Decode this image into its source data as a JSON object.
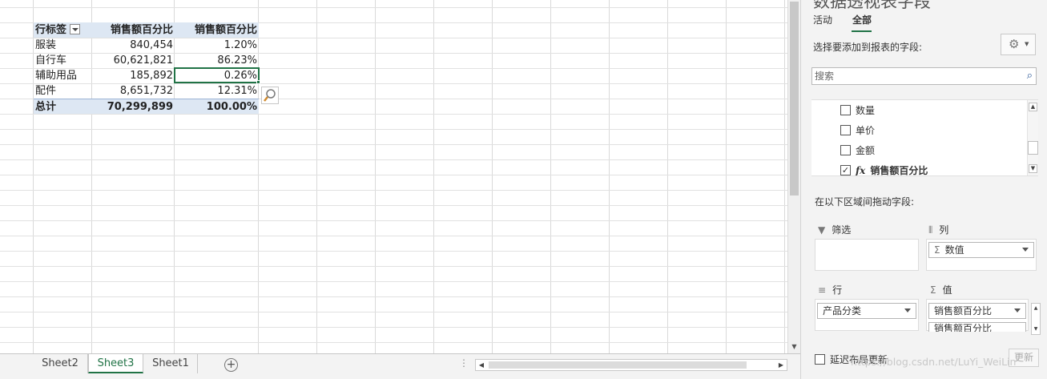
{
  "pivot": {
    "header": {
      "row_label": "行标签",
      "col2": "销售额百分比",
      "col3": "销售额百分比"
    },
    "rows": [
      {
        "label": "服装",
        "amount": "840,454",
        "pct": "1.20%"
      },
      {
        "label": "自行车",
        "amount": "60,621,821",
        "pct": "86.23%"
      },
      {
        "label": "辅助用品",
        "amount": "185,892",
        "pct": "0.26%"
      },
      {
        "label": "配件",
        "amount": "8,651,732",
        "pct": "12.31%"
      }
    ],
    "total": {
      "label": "总计",
      "amount": "70,299,899",
      "pct": "100.00%"
    }
  },
  "sheet_tabs": {
    "tab1": "Sheet2",
    "tab2": "Sheet3",
    "tab3": "Sheet1",
    "active": "Sheet3"
  },
  "panel": {
    "title": "数据透视表字段",
    "tab_active": "活动",
    "tab_all": "全部",
    "choose_label": "选择要添加到报表的字段:",
    "search_placeholder": "搜索",
    "fields": [
      {
        "name": "数量",
        "checked": false
      },
      {
        "name": "单价",
        "checked": false
      },
      {
        "name": "金额",
        "checked": false
      },
      {
        "name": "销售额百分比",
        "checked": true,
        "calc": "fx"
      }
    ],
    "drag_label": "在以下区域间拖动字段:",
    "filter_title": "筛选",
    "columns_title": "列",
    "columns_item": "数值",
    "rows_title": "行",
    "rows_item": "产品分类",
    "values_title": "值",
    "values_item1": "销售额百分比",
    "values_item2": "销售额百分比",
    "defer_label": "延迟布局更新",
    "update_label": "更新"
  },
  "watermark": "https://blog.csdn.net/LuYi_WeiLin",
  "colors": {
    "accent": "#217346",
    "pivot_header": "#dde7f3"
  }
}
